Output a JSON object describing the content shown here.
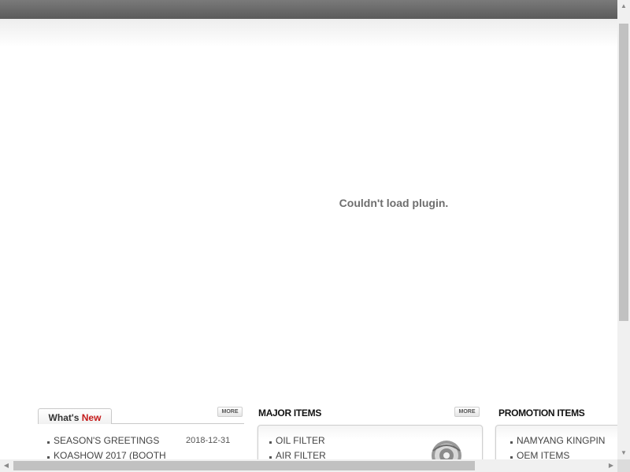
{
  "plugin": {
    "message": "Couldn't load plugin."
  },
  "whats_new": {
    "tab_prefix": "What's",
    "tab_accent": "New",
    "more_label": "MORE",
    "items": [
      {
        "title": "SEASON'S GREETINGS",
        "date": "2018-12-31"
      },
      {
        "title": "KOASHOW 2017 (BOOTH",
        "date": ""
      }
    ]
  },
  "major_items": {
    "title": "MAJOR ITEMS",
    "more_label": "MORE",
    "items": [
      "OIL FILTER",
      "AIR FILTER"
    ],
    "thumb_icon": "filter-part-icon"
  },
  "promotion_items": {
    "title": "PROMOTION ITEMS",
    "items": [
      "NAMYANG KINGPIN",
      "OEM ITEMS"
    ]
  },
  "colors": {
    "topbar": "#5b5b5b",
    "accent_red": "#c41a1a",
    "plugin_text": "#6e6e6e"
  }
}
